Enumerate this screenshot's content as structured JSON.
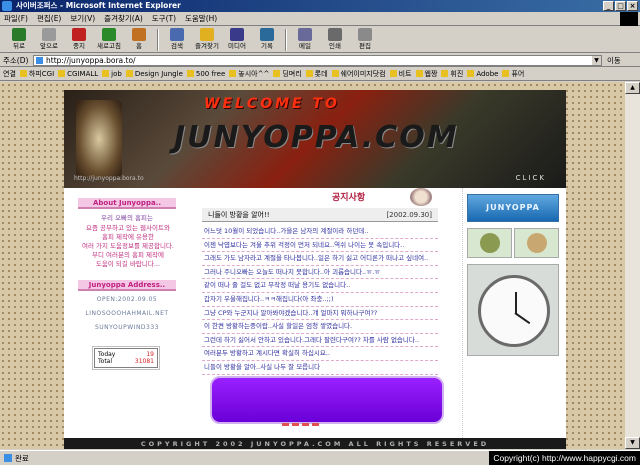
{
  "window": {
    "title": "사이버조퍼스 - Microsoft Internet Explorer",
    "controls": [
      "_",
      "□",
      "×"
    ]
  },
  "menu": [
    "파일(F)",
    "편집(E)",
    "보기(V)",
    "즐겨찾기(A)",
    "도구(T)",
    "도움말(H)"
  ],
  "toolbar": {
    "buttons": [
      {
        "label": "뒤로",
        "icon": "back-arrow-icon",
        "color": "#2a7a2a"
      },
      {
        "label": "앞으로",
        "icon": "forward-arrow-icon",
        "color": "#9a9a9a"
      },
      {
        "label": "중지",
        "icon": "stop-icon",
        "color": "#c02020"
      },
      {
        "label": "새로고침",
        "icon": "refresh-icon",
        "color": "#2a8a2a"
      },
      {
        "label": "홈",
        "icon": "home-icon",
        "color": "#c07020"
      },
      {
        "label": "검색",
        "icon": "search-icon",
        "color": "#4a6ab0"
      },
      {
        "label": "즐겨찾기",
        "icon": "favorites-icon",
        "color": "#e0b020"
      },
      {
        "label": "미디어",
        "icon": "media-icon",
        "color": "#3a3a8a"
      },
      {
        "label": "기록",
        "icon": "history-icon",
        "color": "#2a6a9a"
      },
      {
        "label": "메일",
        "icon": "mail-icon",
        "color": "#6a6a9a"
      },
      {
        "label": "인쇄",
        "icon": "print-icon",
        "color": "#6a6a6a"
      },
      {
        "label": "편집",
        "icon": "edit-icon",
        "color": "#8a8a8a"
      }
    ]
  },
  "address": {
    "label": "주소(D)",
    "value": "http://junyoppa.bora.to/",
    "go_label": "이동"
  },
  "links": {
    "label": "연결",
    "items": [
      "하피CGI",
      "CGIMALL",
      "job",
      "Design Jungle",
      "500 free",
      "놓시아^^",
      "딩며리",
      "롯데",
      "쉐어이미지닷컴",
      "비트",
      "웹짱",
      "휘진",
      "Adobe",
      "퓨어"
    ]
  },
  "banner": {
    "welcome": "WELCOME TO",
    "logo": "JUNYOPPA.COM",
    "url": "http://junyoppa.bora.to",
    "click": "CLICK"
  },
  "about": {
    "head": "About Junyoppa..",
    "sub": "우리 오빠의 홈피는",
    "lines": [
      "요즘 공부하고 있는 웹사이트와",
      "홈피 제작에 유용한",
      "여러 가지 도움정보를 제공합니다.",
      "부디 여러분의 홈피 제작에",
      "도움이 되길 바랍니다..."
    ]
  },
  "address_box": {
    "head": "Junyoppa Address..",
    "open": "OPEN:2002.09.05",
    "email": "LINOSOOOHAHMAIL.NET",
    "phone": "SUNYOUPWIND333"
  },
  "counter": {
    "today_label": "Today",
    "today_value": "19",
    "total_label": "Total",
    "total_value": "31081"
  },
  "notice": {
    "title": "공지사항",
    "head_text": "니들이 방황을 알어!!",
    "head_date": "[2002.09.30]",
    "items": [
      "어느덧 10월이 되었습니다..가을은 남자의 계절이라 하던데..",
      "이젠 낙엽보다는 겨울 추위 걱정이 먼저 되네요..역쉬 나이는 못 속입니다..",
      "그래도 가도 남자라고 계절을 타나봅니다..일은 하기 싫고 어디론가 떠나고 싶네여..",
      "그러나 주니오빠는 오늘도 떠나지 못합니다..아 괴롭습니다..ㅠ.ㅠ",
      "같이 떠나 줄 걸도 없고 무작정 떠날 용기도 없습니다..",
      "갑자기 우울해집니다..ㅋㅋ해집니다(아 좌충..;;)",
      "그냥 CP와 누군지나 알아봐야겠습니다..걔 얼마지 뭐하나구여??",
      "이 한켠 방황하는중이랍..사실 할일은 엄청 쌓였습니다.",
      "그런데 하기 싫어서 안하고 있습니다.그래다 팔련다구여?? 차를 사람 없습니다..",
      "여러분두 방황하고 계시다면 확실히 하십시요..",
      "니들이 방황을 알아..사실 나두 잘 모릅니다"
    ]
  },
  "right": {
    "logo": "JUNYOPPA"
  },
  "footer": {
    "text": "COPYRIGHT 2002 JUNYOPPA.COM ALL RIGHTS RESERVED"
  },
  "status": {
    "text": "완료"
  },
  "copyright": "Copyright(c) http://www.happycgi.com"
}
